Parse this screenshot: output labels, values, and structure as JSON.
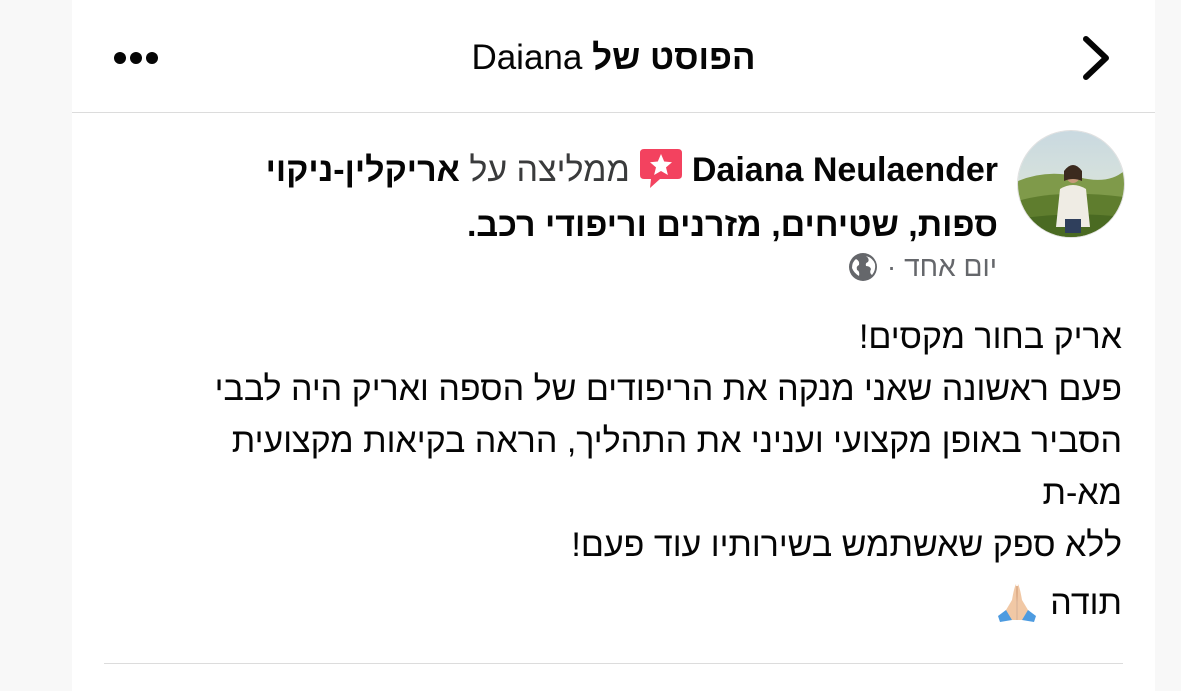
{
  "header": {
    "title_prefix": "הפוסט של",
    "title_name": "Daiana",
    "more_icon": "more-horizontal-icon",
    "back_icon": "chevron-right-icon"
  },
  "post": {
    "author": "Daiana Neulaender",
    "recommend_text": "ממליצה על",
    "business": "אריקלין-ניקוי ספות, שטיחים, מזרנים וריפודי רכב.",
    "time": "יום אחד",
    "separator": "·",
    "privacy_icon": "globe-icon",
    "badge_icon": "recommendation-star-icon",
    "body_lines": [
      "אריק בחור מקסים!",
      "פעם ראשונה שאני מנקה את הריפודים של הספה ואריק היה לבבי",
      "הסביר באופן מקצועי ועניני את התהליך, הראה בקיאות מקצועית",
      "מא-ת",
      "ללא ספק שאשתמש בשירותיו עוד פעם!"
    ],
    "thanks": "תודה",
    "thanks_emoji": "folded-hands-icon"
  },
  "colors": {
    "text": "#050505",
    "secondary": "#65676b",
    "badge": "#f3425f",
    "divider": "#dcdcdc"
  }
}
